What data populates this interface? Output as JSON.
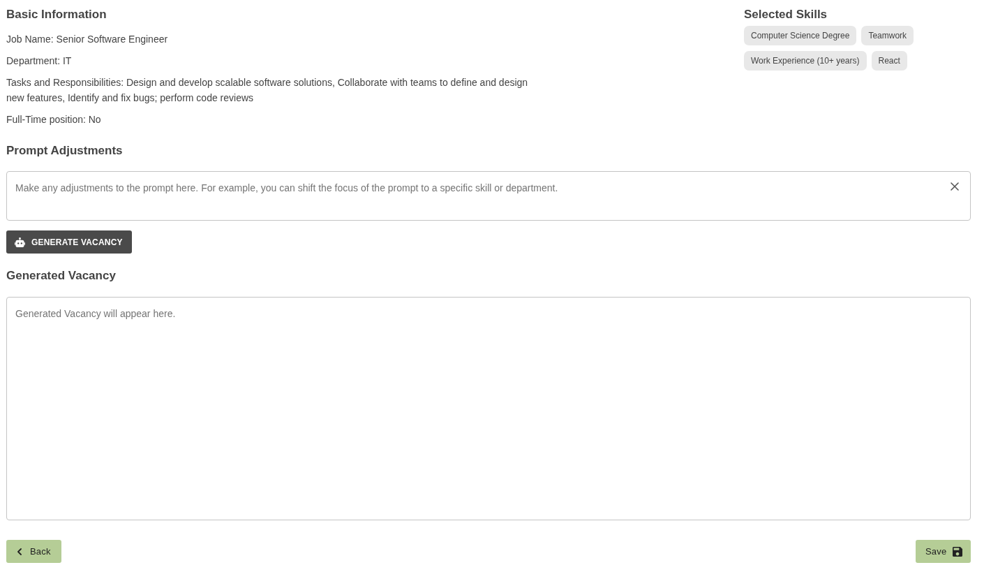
{
  "basic_information": {
    "title": "Basic Information",
    "details": [
      "Job Name: Senior Software Engineer",
      "Department: IT",
      "Tasks and Responsibilities: Design and develop scalable software solutions, Collaborate with teams to define and design new features, Identify and fix bugs; perform code reviews",
      "Full-Time position: No"
    ]
  },
  "selected_skills": {
    "title": "Selected Skills",
    "skills": [
      "Computer Science Degree",
      "Teamwork",
      "Work Experience (10+ years)",
      "React"
    ]
  },
  "prompt_adjustments": {
    "title": "Prompt Adjustments",
    "placeholder": "Make any adjustments to the prompt here. For example, you can shift the focus of the prompt to a specific skill or department.",
    "generate_button": "GENERATE VACANCY"
  },
  "generated_vacancy": {
    "title": "Generated Vacancy",
    "placeholder": "Generated Vacancy will appear here."
  },
  "actions": {
    "back_button": "Back",
    "save_button": "Save"
  }
}
